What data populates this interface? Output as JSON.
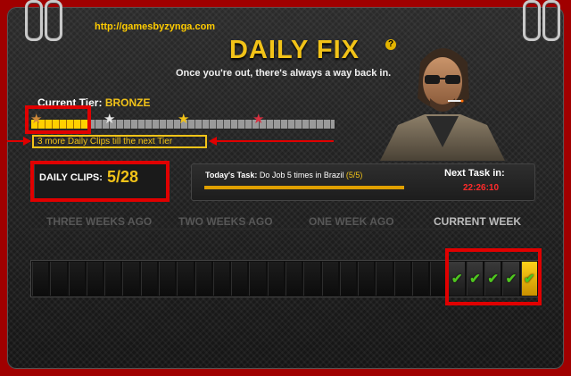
{
  "url": "http://gamesbyzynga.com",
  "header": {
    "title": "DAILY FIX",
    "tagline": "Once you're out, there's always a way back in.",
    "help_symbol": "?"
  },
  "tier": {
    "label": "Current Tier:",
    "name": "BRONZE",
    "progress_fraction": 0.19,
    "note": "3 more Daily Clips till the next Tier",
    "stars": [
      {
        "name": "bronze",
        "color": "#d08a3a"
      },
      {
        "name": "silver",
        "color": "#e6e6e6"
      },
      {
        "name": "gold",
        "color": "#f2c318"
      },
      {
        "name": "ruby",
        "color": "#d83040"
      }
    ]
  },
  "clips": {
    "label": "DAILY CLIPS:",
    "value": "5/28"
  },
  "task": {
    "label": "Today's Task:",
    "text": "Do Job 5 times in Brazil",
    "progress": "(5/5)",
    "progress_fraction": 1.0,
    "next_label": "Next Task in:",
    "next_time": "22:26:10"
  },
  "weeks": [
    "THREE WEEKS AGO",
    "TWO WEEKS AGO",
    "ONE WEEK AGO",
    "CURRENT WEEK"
  ],
  "days": {
    "total": 28,
    "completed": 5,
    "check_symbol": "✔"
  },
  "colors": {
    "accent": "#f2c318",
    "annotation": "#e00000",
    "check": "#4fc51f"
  }
}
